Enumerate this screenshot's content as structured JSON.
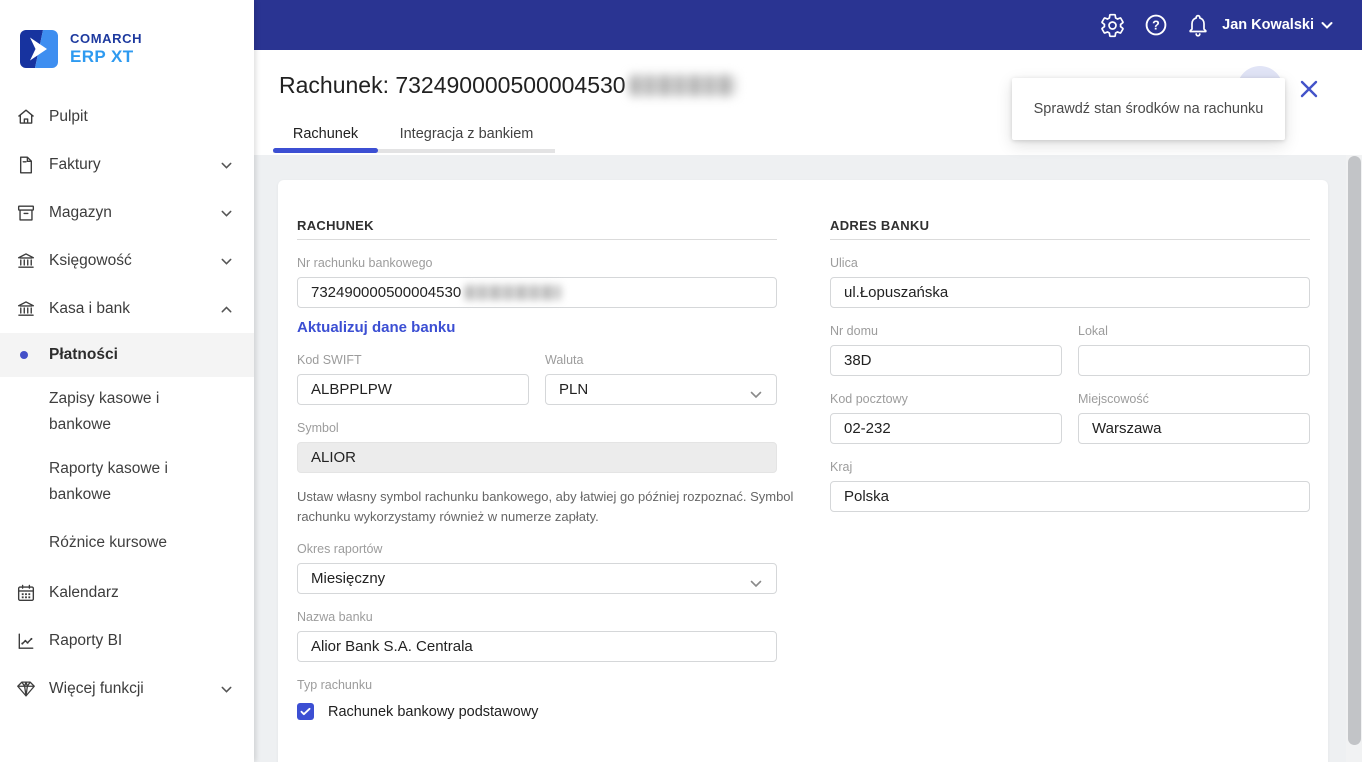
{
  "brand": {
    "line1": "COMARCH",
    "line2": "ERP XT"
  },
  "topbar": {
    "user_name": "Jan Kowalski"
  },
  "sidebar": {
    "items": [
      {
        "label": "Pulpit"
      },
      {
        "label": "Faktury"
      },
      {
        "label": "Magazyn"
      },
      {
        "label": "Księgowość"
      },
      {
        "label": "Kasa i bank"
      },
      {
        "label": "Kalendarz"
      },
      {
        "label": "Raporty BI"
      },
      {
        "label": "Więcej funkcji"
      }
    ],
    "kasa_subitems": [
      {
        "label": "Płatności",
        "active": true
      },
      {
        "label": "Zapisy kasowe i bankowe"
      },
      {
        "label": "Raporty kasowe i bankowe"
      },
      {
        "label": "Różnice kursowe"
      }
    ]
  },
  "header": {
    "title": "Rachunek: 732490000500004530",
    "tabs": [
      {
        "label": "Rachunek",
        "active": true
      },
      {
        "label": "Integracja z bankiem",
        "active": false
      }
    ]
  },
  "tooltip": {
    "text": "Sprawdź stan środków na rachunku"
  },
  "form": {
    "rachunek": {
      "section_title": "RACHUNEK",
      "account_number_label": "Nr rachunku bankowego",
      "account_number_value": "732490000500004530",
      "update_bank_link": "Aktualizuj dane banku",
      "swift_label": "Kod SWIFT",
      "swift_value": "ALBPPLPW",
      "currency_label": "Waluta",
      "currency_value": "PLN",
      "symbol_label": "Symbol",
      "symbol_value": "ALIOR",
      "symbol_hint": "Ustaw własny symbol rachunku bankowego, aby łatwiej go później rozpoznać. Symbol rachunku wykorzystamy również w numerze zapłaty.",
      "report_period_label": "Okres raportów",
      "report_period_value": "Miesięczny",
      "bank_name_label": "Nazwa banku",
      "bank_name_value": "Alior Bank S.A. Centrala",
      "account_type_label": "Typ rachunku",
      "account_type_checkbox_label": "Rachunek bankowy podstawowy",
      "account_type_checked": true
    },
    "adres_banku": {
      "section_title": "ADRES BANKU",
      "street_label": "Ulica",
      "street_value": "ul.Łopuszańska",
      "house_label": "Nr domu",
      "house_value": "38D",
      "unit_label": "Lokal",
      "unit_value": "",
      "postal_label": "Kod pocztowy",
      "postal_value": "02-232",
      "city_label": "Miejscowość",
      "city_value": "Warszawa",
      "country_label": "Kraj",
      "country_value": "Polska"
    }
  },
  "colors": {
    "accent": "#3c4fd3",
    "topbar": "#2a3492"
  }
}
